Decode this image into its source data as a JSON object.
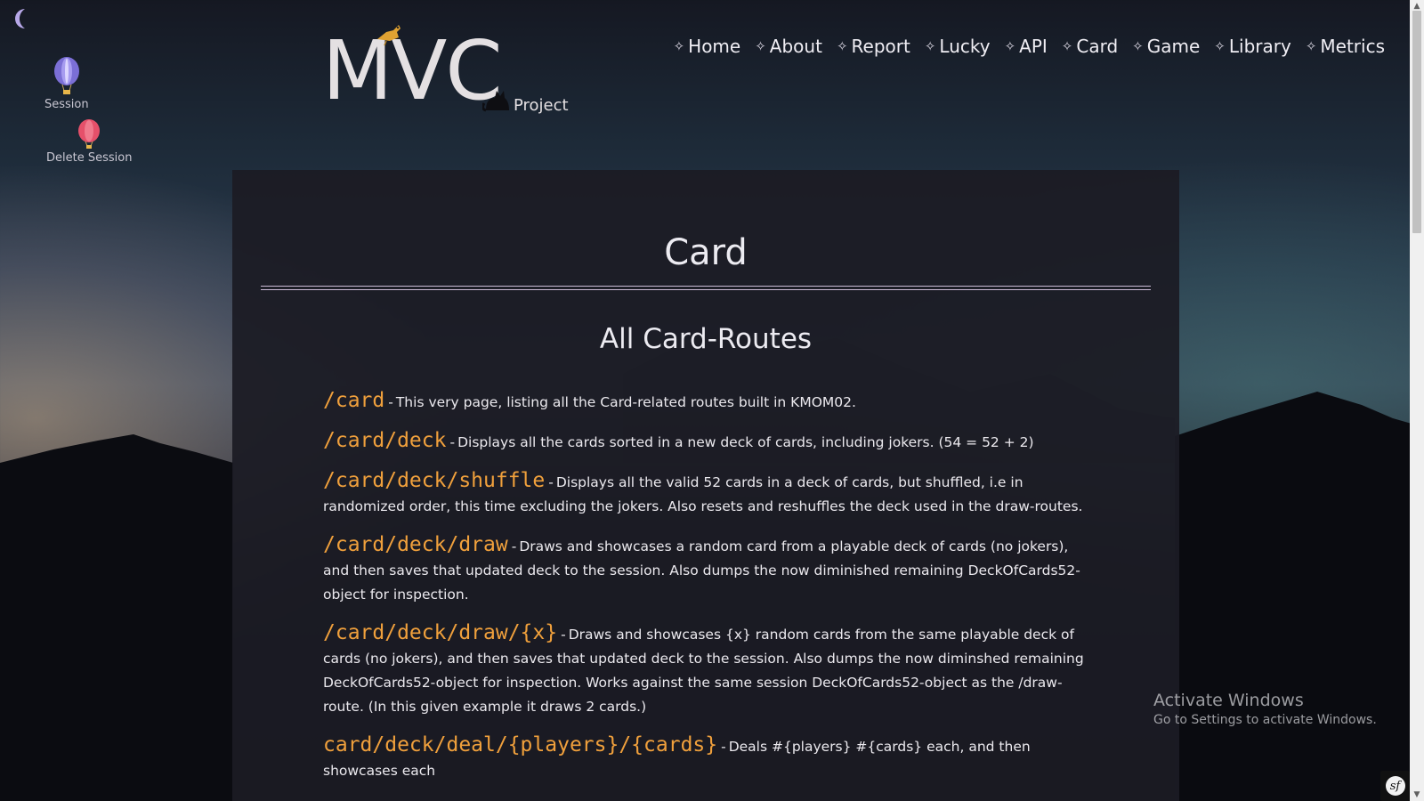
{
  "logo": {
    "title": "MVC",
    "subtitle": "Project"
  },
  "sidebar": {
    "theme_toggle_icon": "moon-icon",
    "items": [
      {
        "label": "Session",
        "icon": "balloon-blue-icon",
        "color": "#7b6fd6"
      },
      {
        "label": "Delete Session",
        "icon": "balloon-red-icon",
        "color": "#e5506a"
      }
    ]
  },
  "nav": {
    "marker": "✧",
    "items": [
      {
        "label": "Home"
      },
      {
        "label": "About"
      },
      {
        "label": "Report"
      },
      {
        "label": "Lucky"
      },
      {
        "label": "API"
      },
      {
        "label": "Card"
      },
      {
        "label": "Game"
      },
      {
        "label": "Library"
      },
      {
        "label": "Metrics"
      }
    ]
  },
  "main": {
    "title": "Card",
    "subtitle": "All Card-Routes",
    "routes": [
      {
        "path": "/card",
        "desc": "This very page, listing all the Card-related routes built in KMOM02."
      },
      {
        "path": "/card/deck",
        "desc": "Displays all the cards sorted in a new deck of cards, including jokers. (54 = 52 + 2)"
      },
      {
        "path": "/card/deck/shuffle",
        "desc": "Displays all the valid 52 cards in a deck of cards, but shuffled, i.e in randomized order, this time excluding the jokers. Also resets and reshuffles the deck used in the draw-routes."
      },
      {
        "path": "/card/deck/draw",
        "desc": "Draws and showcases a random card from a playable deck of cards (no jokers), and then saves that updated deck to the session. Also dumps the now diminished remaining DeckOfCards52-object for inspection."
      },
      {
        "path": "/card/deck/draw/{x}",
        "desc": "Draws and showcases {x} random cards from the same playable deck of cards (no jokers), and then saves that updated deck to the session. Also dumps the now diminshed remaining DeckOfCards52-object for inspection. Works against the same session DeckOfCards52-object as the /draw-route. (In this given example it draws 2 cards.)"
      },
      {
        "path": "card/deck/deal/{players}/{cards}",
        "desc": "Deals #{players} #{cards} each, and then showcases each"
      }
    ],
    "separator": "-"
  },
  "watermark": {
    "line1": "Activate Windows",
    "line2": "Go to Settings to activate Windows."
  },
  "badge": {
    "icon": "symfony-icon",
    "glyph": "sf"
  },
  "colors": {
    "route_path": "#f0a03c",
    "panel_bg": "#1c1c24",
    "rule": "#cbbcd6"
  }
}
